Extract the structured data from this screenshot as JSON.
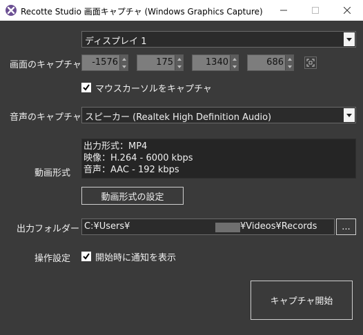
{
  "window": {
    "title": "Recotte Studio 画面キャプチャ (Windows Graphics Capture)"
  },
  "screen_capture": {
    "label": "画面のキャプチャ",
    "display_selected": "ディスプレイ 1",
    "x": "-1576",
    "y": "175",
    "width": "1340",
    "height": "686",
    "mouse_cursor_label": "マウスカーソルをキャプチャ",
    "mouse_cursor_checked": true
  },
  "audio_capture": {
    "label": "音声のキャプチャ",
    "selected": "スピーカー (Realtek High Definition Audio)"
  },
  "video_format": {
    "label": "動画形式",
    "lines": [
      "出力形式：MP4",
      "映像：H.264 - 6000 kbps",
      "音声：AAC - 192 kbps"
    ],
    "settings_button": "動画形式の設定"
  },
  "output_folder": {
    "label": "出力フォルダー",
    "path_prefix": "C:¥Users¥",
    "path_suffix": "¥Videos¥Records",
    "browse_button": "..."
  },
  "operation": {
    "label": "操作設定",
    "notify_label": "開始時に通知を表示",
    "notify_checked": true
  },
  "start_button": "キャプチャ開始"
}
